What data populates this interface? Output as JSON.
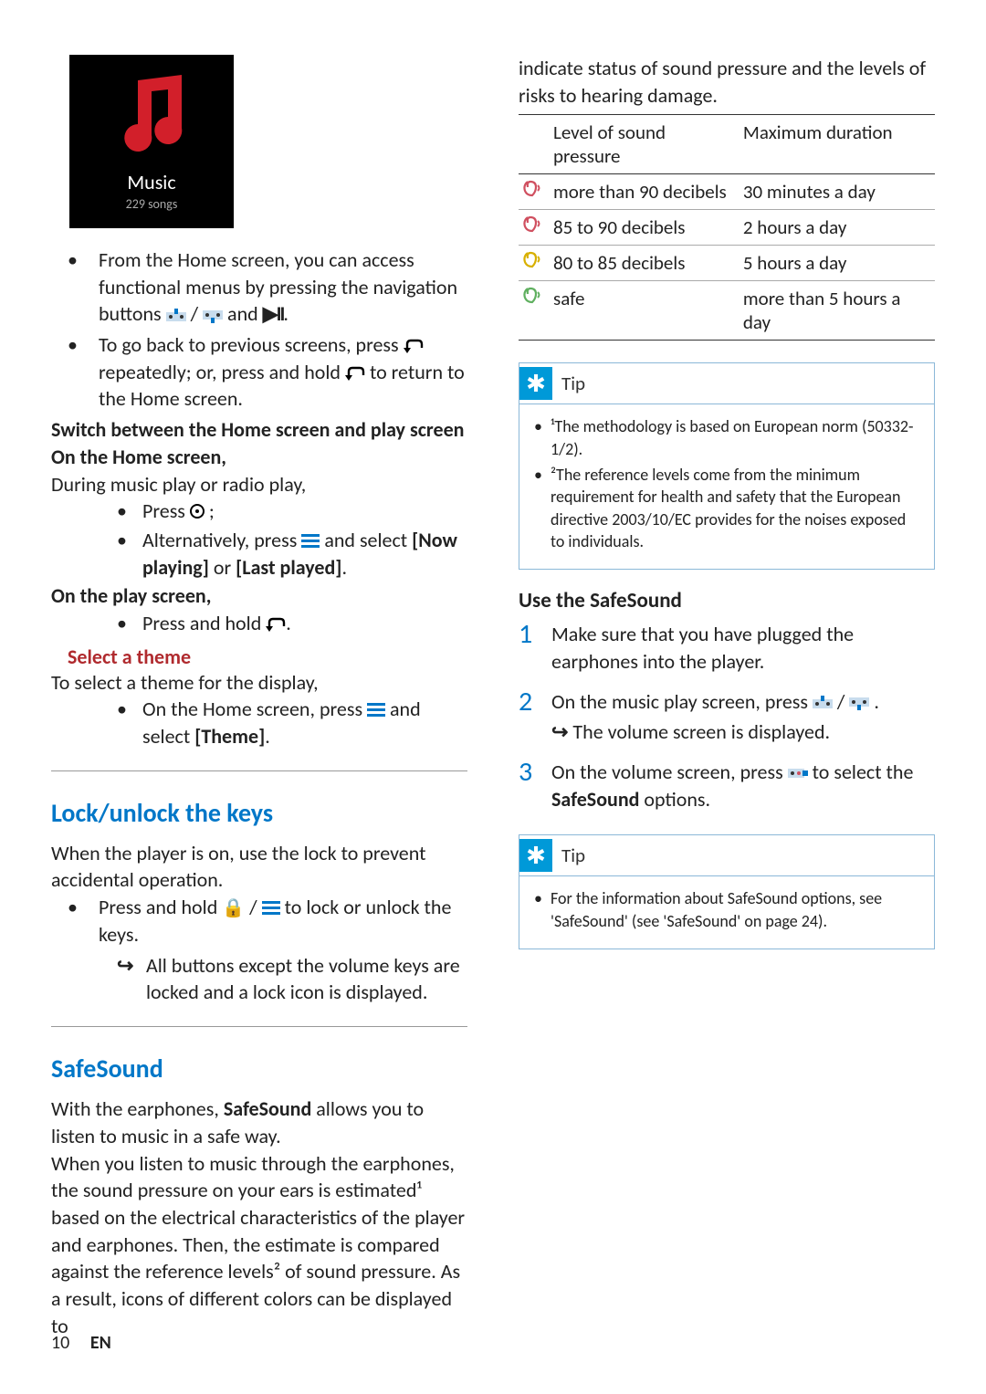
{
  "music_tile": {
    "label": "Music",
    "sub": "229 songs"
  },
  "col1": {
    "home_access_1": "From the Home screen, you can access functional menus by pressing the navigation buttons ",
    "home_access_2": " and ",
    "back_1": "To go back to previous screens, press ",
    "back_2": " repeatedly; or, press and hold ",
    "back_3": " to return to the Home screen.",
    "switch_head": "Switch between the Home screen and play screen",
    "on_home": "On the Home screen,",
    "during": "During music play or radio play,",
    "press_target": "Press ",
    "press_target_end": " ;",
    "alt_press_1": "Alternatively, press ",
    "alt_press_2": " and select ",
    "now_playing": "[Now playing]",
    "or": " or",
    "last_played": "[Last played]",
    "on_play": "On the play screen,",
    "press_hold_back": "Press and hold ",
    "select_theme_head": "Select a theme",
    "select_theme_intro": "To select a theme for the display,",
    "theme_step_1": "On the Home screen, press ",
    "theme_step_2": " and select ",
    "theme_bold": "[Theme]",
    "lock_head": "Lock/unlock the keys",
    "lock_intro": "When the player is on, use the lock to prevent accidental operation.",
    "lock_step_1": "Press and hold ",
    "lock_step_2": " to lock or unlock the keys.",
    "lock_result": "All buttons except the volume keys are locked and a lock icon is displayed.",
    "safesound_head": "SafeSound",
    "ss_p1a": "With the earphones, ",
    "ss_p1_bold": "SafeSound",
    "ss_p1b": " allows you to listen to music in a safe way.",
    "ss_p2": "When you listen to music through the earphones, the sound pressure on your ears is estimated¹ based on the electrical characteristics of the player and earphones. Then, the estimate is compared against the reference levels² of sound pressure. As a result, icons of different colors can be displayed to"
  },
  "col2": {
    "cont": "indicate status of sound pressure and the levels of risks to hearing damage.",
    "table": {
      "h1": "Level of sound pressure",
      "h2": "Maximum duration",
      "rows": [
        {
          "color": "#d05060",
          "level": "more than 90 decibels",
          "dur": "30 minutes a day"
        },
        {
          "color": "#d05060",
          "level": "85 to 90 decibels",
          "dur": "2 hours a day"
        },
        {
          "color": "#d8b000",
          "level": "80 to 85 decibels",
          "dur": "5 hours a day"
        },
        {
          "color": "#60b060",
          "level": "safe",
          "dur": "more than 5 hours a day"
        }
      ]
    },
    "tip1_label": "Tip",
    "tip1_items": [
      "¹The methodology is based on European norm (50332-1/2).",
      "²The reference levels come from the minimum requirement for health and safety that the European directive 2003/10/EC provides for the noises exposed to individuals."
    ],
    "use_head": "Use the SafeSound",
    "steps": [
      {
        "n": "1",
        "text": "Make sure that you have plugged the earphones into the player."
      },
      {
        "n": "2",
        "text_a": "On the music play screen, press ",
        "text_b": " .",
        "sub": "The volume screen is displayed."
      },
      {
        "n": "3",
        "text_a": "On the volume screen, press ",
        "text_b": " to select the ",
        "bold": "SafeSound",
        "text_c": " options."
      }
    ],
    "tip2_label": "Tip",
    "tip2_items": [
      "For the information about SafeSound options, see 'SafeSound' (see 'SafeSound' on page 24)."
    ]
  },
  "footer": {
    "page": "10",
    "lang": "EN"
  }
}
